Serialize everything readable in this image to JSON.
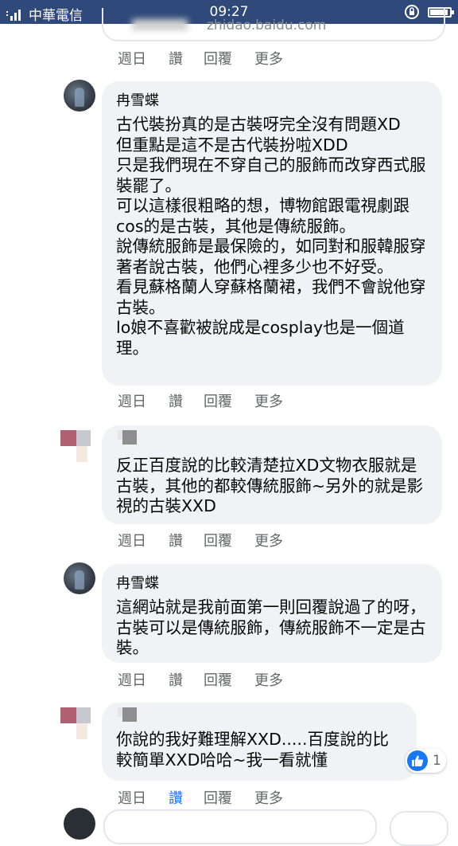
{
  "status_bar": {
    "carrier": "中華電信",
    "time": "09:27",
    "battery_level": 0.9
  },
  "link_preview": {
    "url": "zhidao.baidu.com"
  },
  "comments": [
    {
      "author": "冉雪蝶",
      "text": "古代裝扮真的是古裝呀完全沒有問題XD\n但重點是這不是古代裝扮啦XDD\n只是我們現在不穿自己的服飾而改穿西式服裝罷了。\n可以這樣很粗略的想，博物館跟電視劇跟cos的是古裝，其他是傳統服飾。\n說傳統服飾是最保險的，如同對和服韓服穿著者說古裝，他們心裡多少也不好受。\n看見蘇格蘭人穿蘇格蘭裙，我們不會說他穿古裝。\nlo娘不喜歡被說成是cosplay也是一個道理。"
    },
    {
      "author": "",
      "text": "反正百度說的比較清楚拉XD文物衣服就是古裝，其他的都較傳統服飾~另外的就是影視的古裝XXD"
    },
    {
      "author": "冉雪蝶",
      "text": "這網站就是我前面第一則回覆說過了的呀，古裝可以是傳統服飾，傳統服飾不一定是古裝。"
    },
    {
      "author": "",
      "text": "你說的我好難理解XXD.....百度說的比較簡單XXD哈哈~我一看就懂",
      "reaction_count": "1"
    }
  ],
  "actions": {
    "week": "週日",
    "like": "讚",
    "reply": "回覆",
    "more": "更多"
  },
  "colors": {
    "status_bar": "#2f4a7a",
    "bubble": "#f0f2f5",
    "action_text": "#65676b",
    "liked": "#1877f2"
  }
}
